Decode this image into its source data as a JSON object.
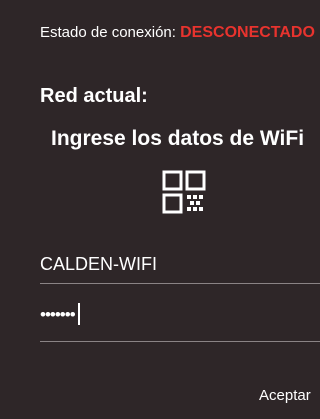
{
  "status": {
    "label": "Estado de conexión: ",
    "value": "DESCONECTADO",
    "value_color": "#e8332e"
  },
  "current_network": {
    "label": "Red actual:"
  },
  "wifi_form": {
    "heading": "Ingrese los datos de WiFi",
    "qr_icon": "qr-code-icon",
    "ssid_value": "CALDEN-WIFI",
    "password_value": "•••••••",
    "accept_label": "Aceptar"
  },
  "colors": {
    "background": "#2e2628",
    "text": "#ffffff",
    "underline": "#8a8385"
  }
}
